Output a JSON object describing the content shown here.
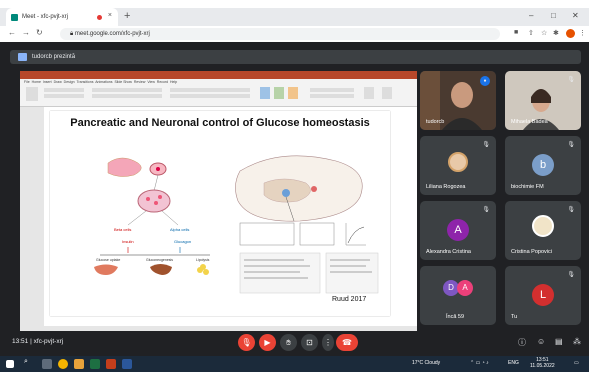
{
  "browser": {
    "tab_title": "Meet - xfc-pvjt-xrj",
    "url": "meet.google.com/xfc-pvjt-xrj",
    "new_tab_glyph": "+",
    "close_glyph": "×",
    "minimize_glyph": "–",
    "maximize_glyph": "□",
    "window_close_glyph": "✕"
  },
  "meet": {
    "presenter_banner": "tudorcb prezintă",
    "slide": {
      "title": "Pancreatic and Neuronal control of Glucose homeostasis",
      "credit": "Ruud 2017"
    },
    "participants": [
      {
        "name": "tudorcb",
        "kind": "video"
      },
      {
        "name": "Mihaela Badea",
        "kind": "video"
      },
      {
        "name": "Liliana Rogozea",
        "kind": "photo"
      },
      {
        "name": "biochimie FM",
        "kind": "letter",
        "letter": "b",
        "color": "#7b9ec9"
      },
      {
        "name": "Alexandra Cristina",
        "kind": "letter",
        "letter": "A",
        "color": "#8e24aa"
      },
      {
        "name": "Cristina Popovici",
        "kind": "photo"
      },
      {
        "name": "Încă 59",
        "kind": "group",
        "letters": [
          "D",
          "A"
        ],
        "colors": [
          "#7e57c2",
          "#ec407a"
        ]
      },
      {
        "name": "Tu",
        "kind": "letter",
        "letter": "L",
        "color": "#d32f2f"
      }
    ],
    "meeting_info": "13:51 | xfc-pvjt-xrj"
  },
  "taskbar": {
    "weather": "17°C Cloudy",
    "time": "13:51",
    "date": "11.05.2022",
    "lang": "ENG"
  }
}
